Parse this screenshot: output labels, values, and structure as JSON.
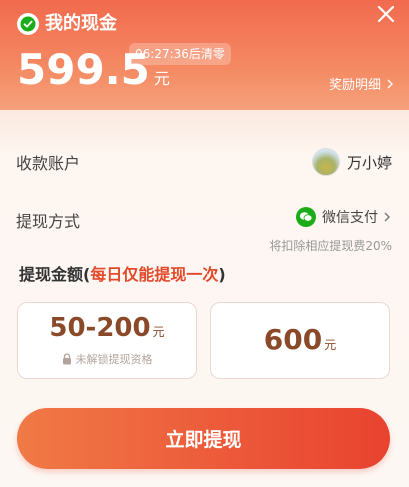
{
  "header": {
    "title": "我的现金",
    "balance": "599.5",
    "balance_unit": "元",
    "countdown": "06:27:36后清零",
    "reward_link": "奖励明细"
  },
  "account": {
    "label": "收款账户",
    "name": "万小婷"
  },
  "method": {
    "label": "提现方式",
    "name": "微信支付",
    "fee_note": "将扣除相应提现费20%"
  },
  "amount": {
    "title_prefix": "提现金额(",
    "title_highlight": "每日仅能提现一次",
    "title_suffix": ")",
    "options": [
      {
        "value": "50-200",
        "unit": "元",
        "note": "未解锁提现资格"
      },
      {
        "value": "600",
        "unit": "元"
      }
    ]
  },
  "cta_label": "立即提现",
  "colors": {
    "brand_orange": "#f26a4e",
    "highlight_red": "#e24a2b",
    "wechat_green": "#1aad19"
  }
}
